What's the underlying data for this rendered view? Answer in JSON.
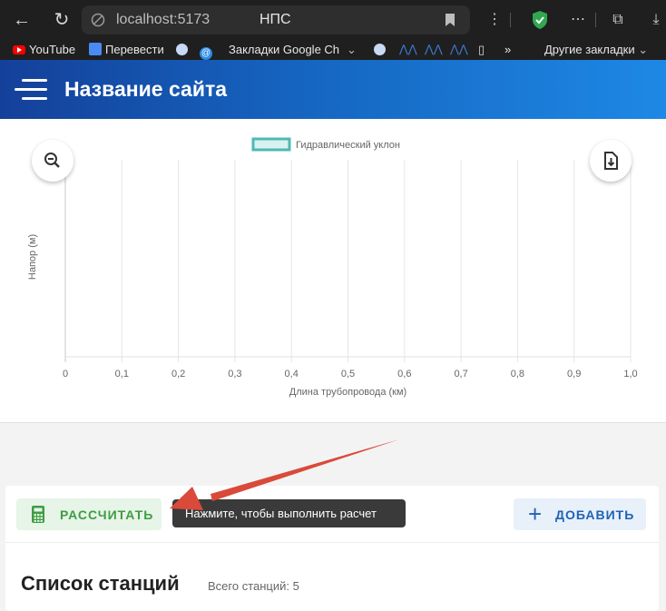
{
  "browser": {
    "url": "localhost:5173",
    "tab_title": "НПС",
    "bookmarks": {
      "youtube": "YouTube",
      "translate": "Перевести",
      "google_bookmarks": "Закладки Google Ch",
      "more": "»",
      "other": "Другие закладки"
    }
  },
  "header": {
    "title": "Название сайта"
  },
  "chart_data": {
    "type": "line",
    "series": [
      {
        "name": "Гидравлический уклон",
        "x": [],
        "y": []
      }
    ],
    "xlabel": "Длина трубопровода (км)",
    "ylabel": "Напор (м)",
    "xlim": [
      0,
      1.0
    ],
    "xticks": [
      "0",
      "0,1",
      "0,2",
      "0,3",
      "0,4",
      "0,5",
      "0,6",
      "0,7",
      "0,8",
      "0,9",
      "1,0"
    ],
    "grid": true,
    "legend": "top-center",
    "colors": {
      "series_fill": "#d9f1ef",
      "series_stroke": "#4fb9b3"
    }
  },
  "actions": {
    "calculate_label": "РАССЧИТАТЬ",
    "add_label": "ДОБАВИТЬ",
    "tooltip": "Нажмите, чтобы выполнить расчет"
  },
  "stations": {
    "title": "Список станций",
    "count_label": "Всего станций: 5"
  },
  "colors": {
    "header_start": "#14409a",
    "header_end": "#1e88e5",
    "calc_green": "#3e9d42",
    "add_blue": "#1f62b5",
    "annotation_arrow": "#d94a3a"
  }
}
